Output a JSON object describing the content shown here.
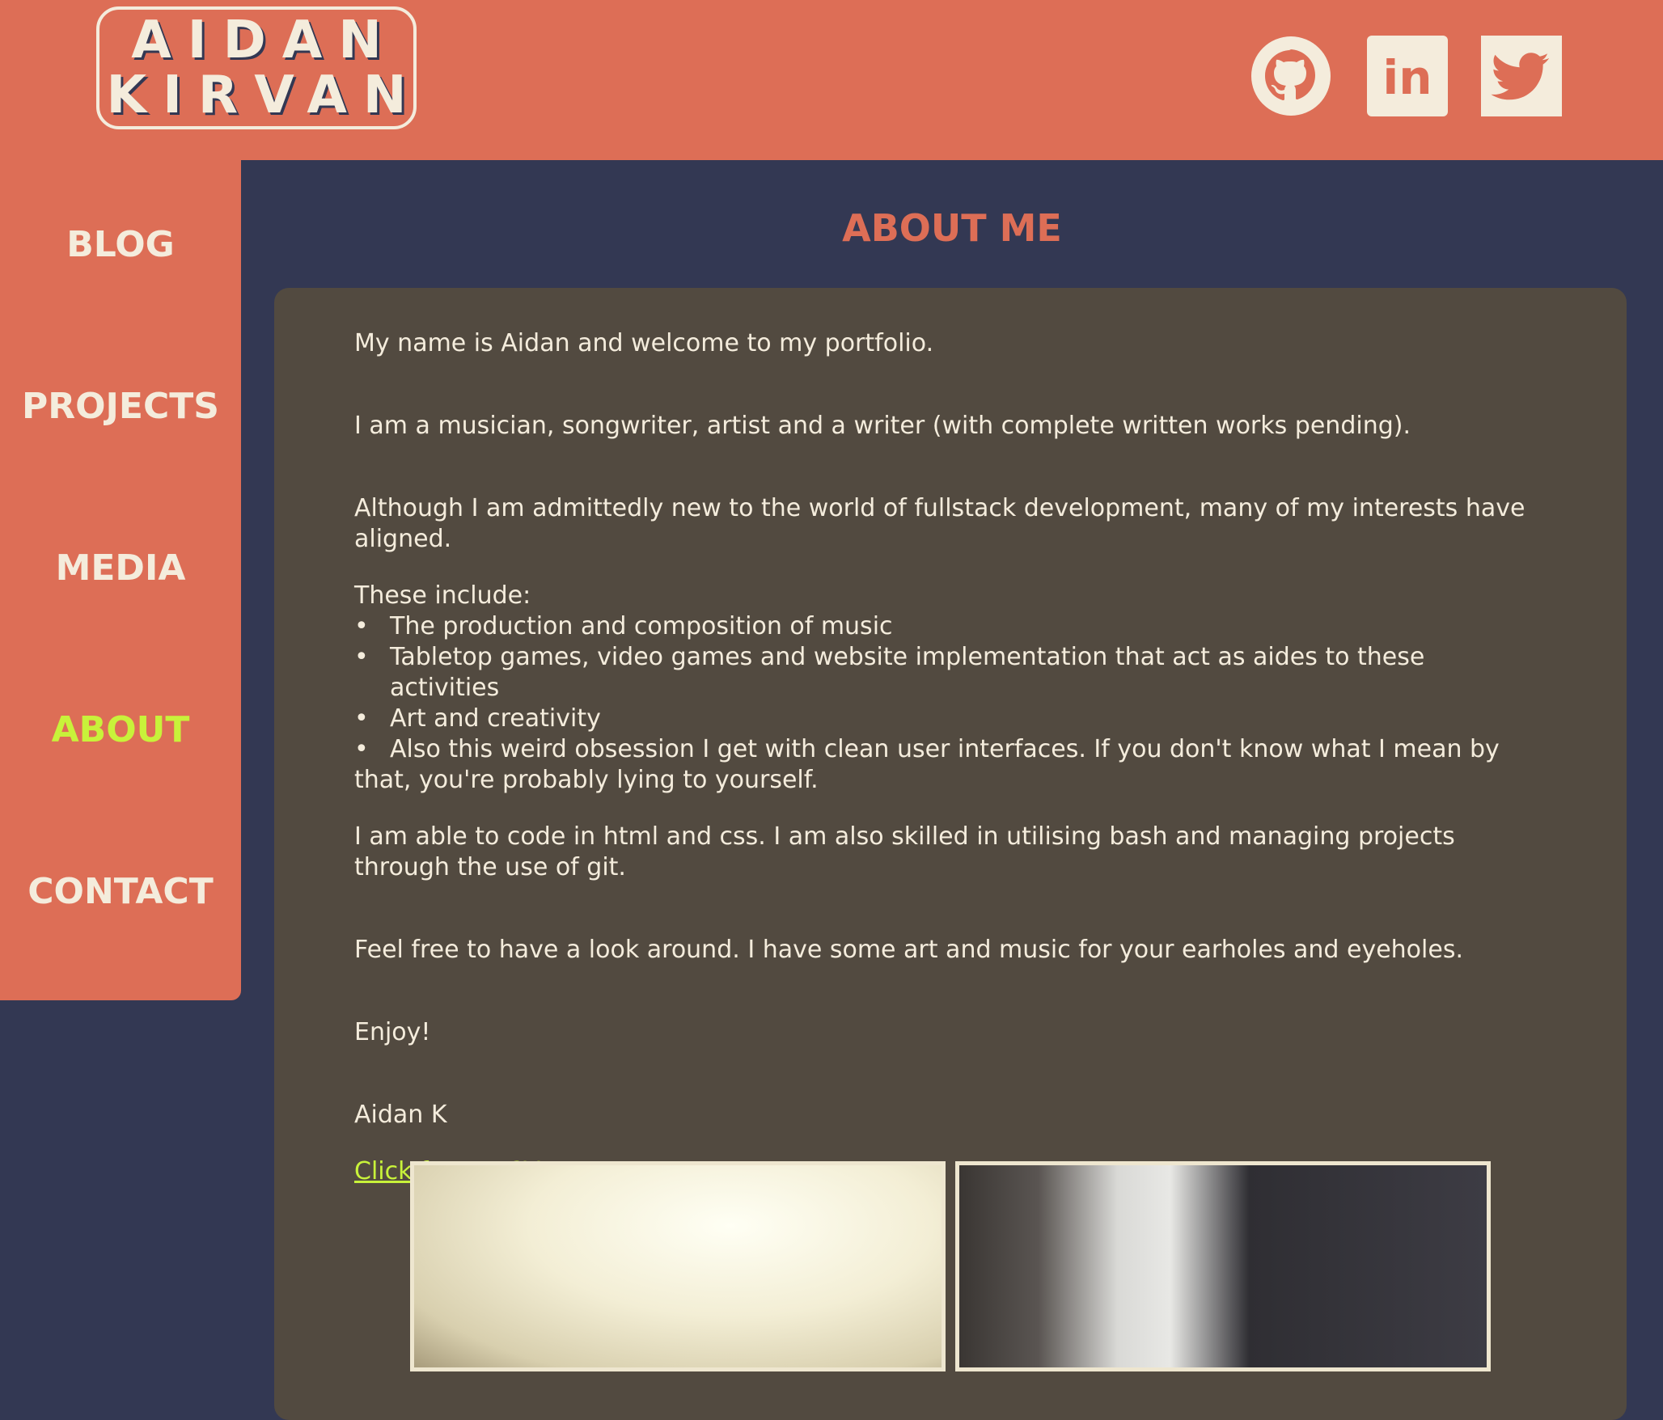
{
  "logo": {
    "line1": "AIDAN",
    "line2": "KIRVAN"
  },
  "social": [
    {
      "name": "github",
      "icon": "github-icon"
    },
    {
      "name": "linkedin",
      "icon": "linkedin-icon",
      "text": "in"
    },
    {
      "name": "twitter",
      "icon": "twitter-icon"
    }
  ],
  "nav": {
    "items": [
      {
        "label": "BLOG"
      },
      {
        "label": "PROJECTS"
      },
      {
        "label": "MEDIA"
      },
      {
        "label": "ABOUT",
        "active": true
      },
      {
        "label": "CONTACT"
      }
    ]
  },
  "main": {
    "title": "ABOUT ME",
    "paragraphs": {
      "intro": "My name is Aidan and welcome to my portfolio.",
      "roles": "I am a musician, songwriter, artist and a writer (with complete written works pending).",
      "background": "Although I am admittedly new to the world of fullstack development, many of my interests have aligned.",
      "interests_heading": "These include:",
      "skills": "I am able to code in html and css. I am also skilled in utilising bash and managing projects through the use of git.",
      "invite": "Feel free to have a look around. I have some art and music for your earholes and eyeholes.",
      "closing": "Enjoy!",
      "signature": "Aidan K"
    },
    "interests": [
      "The production and composition of music",
      "Tabletop games, video games and website implementation that act as aides to these activities",
      "Art and creativity",
      "Also this weird obsession I get with clean user interfaces. If you don't know what I mean by that, you're probably lying to yourself."
    ],
    "bullet": "•",
    "cv_link": "Click for my CV"
  },
  "colors": {
    "header_bg": "#dd6e56",
    "page_bg": "#333853",
    "card_bg": "#524a40",
    "text_cream": "#f4ecdc",
    "accent_lime": "#c8f23a"
  }
}
